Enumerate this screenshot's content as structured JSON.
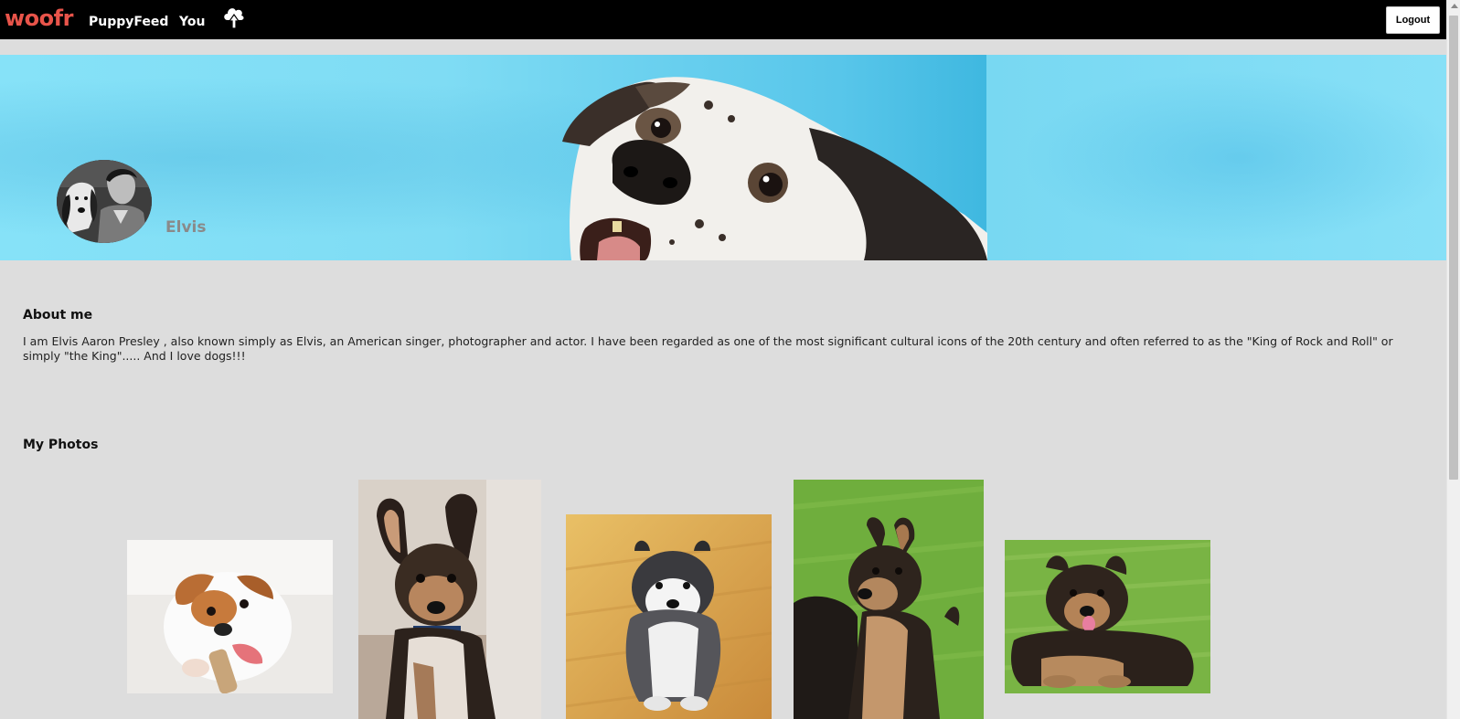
{
  "nav": {
    "logo": "woofr",
    "links": [
      "PuppyFeed",
      "You"
    ],
    "logout_label": "Logout",
    "colors": {
      "logo": "#e8544a",
      "bar": "#000000"
    }
  },
  "profile": {
    "name": "Elvis"
  },
  "about": {
    "title": "About me",
    "text": "I am Elvis Aaron Presley , also known simply as Elvis, an American singer, photographer and actor. I have been regarded as one of the most significant cultural icons of the 20th century and often referred to as the \"King of Rock and Roll\" or simply \"the King\"..... And I love dogs!!!"
  },
  "photos": {
    "title": "My Photos",
    "items": [
      "beagle-puppy-chewing-bone",
      "german-shepherd-puppy-sitting",
      "husky-puppy-on-wood-floor",
      "german-shepherd-puppies-on-grass",
      "german-shepherd-puppy-lying-on-grass"
    ]
  },
  "icons": [
    "upload-cloud-icon",
    "scroll-up-arrow-icon"
  ]
}
